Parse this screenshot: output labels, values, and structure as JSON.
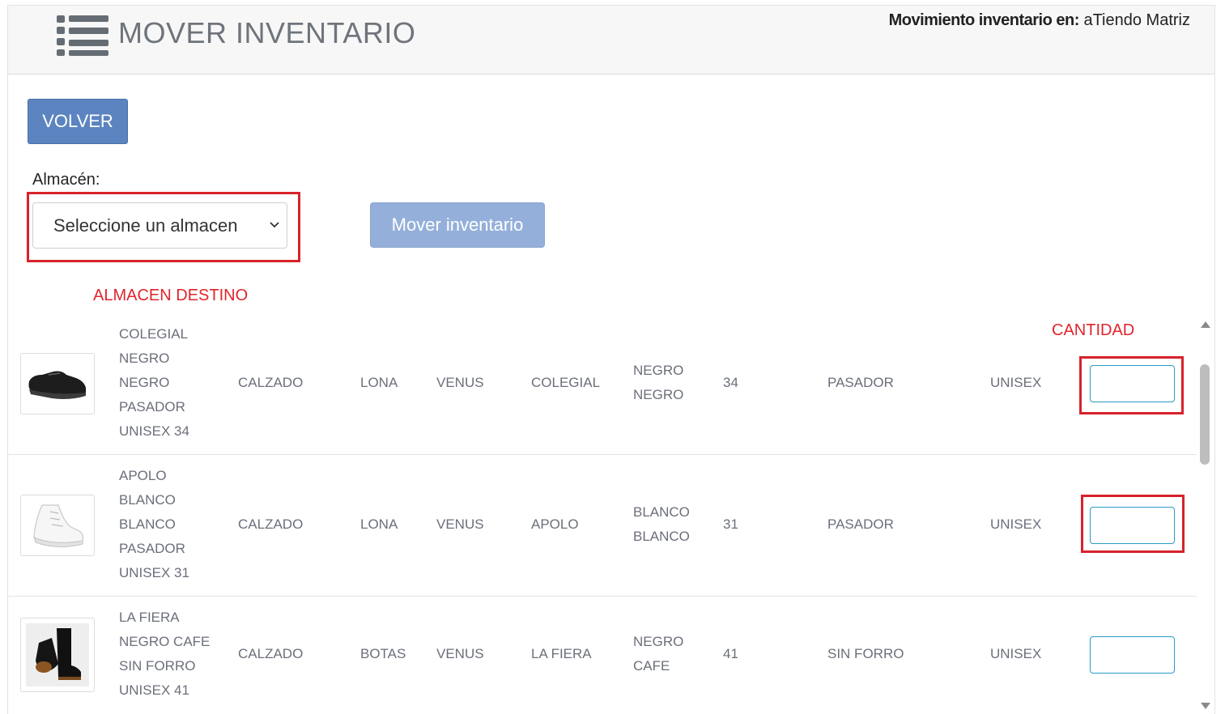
{
  "header": {
    "title": "MOVER INVENTARIO",
    "context_label": "Movimiento inventario en:",
    "context_value": "aTiendo Matriz"
  },
  "toolbar": {
    "back_label": "VOLVER",
    "move_label": "Mover inventario"
  },
  "warehouse": {
    "label": "Almacén:",
    "selected": "Seleccione un almacen"
  },
  "annotations": {
    "destination": "ALMACEN DESTINO",
    "quantity": "CANTIDAD"
  },
  "colors": {
    "accent": "#5b84c0",
    "disabled_button": "#94b0da",
    "annotation_red": "#d8222b",
    "input_border": "#2a9bc7"
  },
  "products": [
    {
      "description_lines": [
        "COLEGIAL",
        "NEGRO",
        "NEGRO",
        "PASADOR",
        "UNISEX 34"
      ],
      "category": "CALZADO",
      "material": "LONA",
      "brand": "VENUS",
      "model": "COLEGIAL",
      "color_lines": [
        "NEGRO",
        "NEGRO"
      ],
      "size": "34",
      "closure": "PASADOR",
      "gender": "UNISEX",
      "image": "black-sneaker-image"
    },
    {
      "description_lines": [
        "APOLO",
        "BLANCO",
        "BLANCO",
        "PASADOR",
        "UNISEX 31"
      ],
      "category": "CALZADO",
      "material": "LONA",
      "brand": "VENUS",
      "model": "APOLO",
      "color_lines": [
        "BLANCO",
        "BLANCO"
      ],
      "size": "31",
      "closure": "PASADOR",
      "gender": "UNISEX",
      "image": "white-high-top-image"
    },
    {
      "description_lines": [
        "LA FIERA",
        "NEGRO CAFE",
        "SIN FORRO",
        "UNISEX 41"
      ],
      "category": "CALZADO",
      "material": "BOTAS",
      "brand": "VENUS",
      "model": "LA FIERA",
      "color_lines": [
        "NEGRO",
        "CAFE"
      ],
      "size": "41",
      "closure": "SIN FORRO",
      "gender": "UNISEX",
      "image": "black-boots-image"
    }
  ]
}
